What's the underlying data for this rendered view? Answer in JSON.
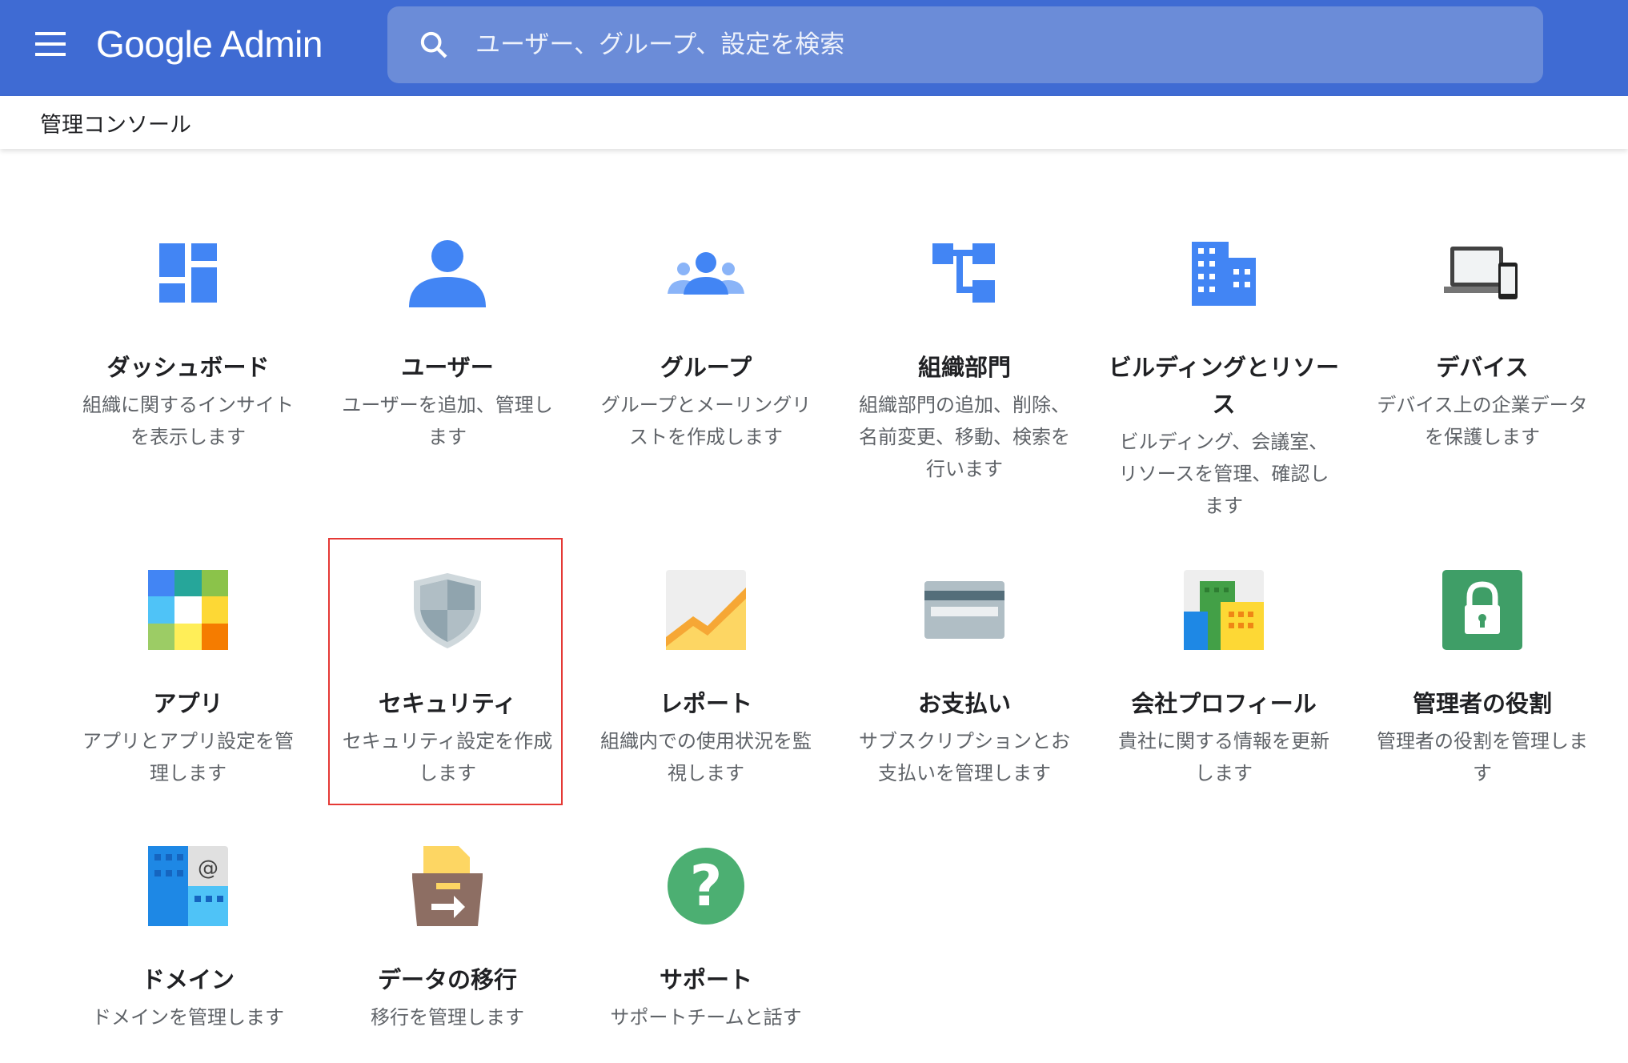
{
  "header": {
    "app_title": "Google Admin",
    "search_placeholder": "ユーザー、グループ、設定を検索"
  },
  "breadcrumb": "管理コンソール",
  "cards": [
    {
      "title": "ダッシュボード",
      "desc": "組織に関するインサイトを表示します",
      "icon": "dashboard-icon"
    },
    {
      "title": "ユーザー",
      "desc": "ユーザーを追加、管理します",
      "icon": "user-icon"
    },
    {
      "title": "グループ",
      "desc": "グループとメーリングリストを作成します",
      "icon": "group-icon"
    },
    {
      "title": "組織部門",
      "desc": "組織部門の追加、削除、名前変更、移動、検索を行います",
      "icon": "org-unit-icon"
    },
    {
      "title": "ビルディングとリソース",
      "desc": "ビルディング、会議室、リソースを管理、確認します",
      "icon": "building-icon"
    },
    {
      "title": "デバイス",
      "desc": "デバイス上の企業データを保護します",
      "icon": "devices-icon"
    },
    {
      "title": "アプリ",
      "desc": "アプリとアプリ設定を管理します",
      "icon": "apps-icon"
    },
    {
      "title": "セキュリティ",
      "desc": "セキュリティ設定を作成します",
      "icon": "shield-icon",
      "highlighted": true
    },
    {
      "title": "レポート",
      "desc": "組織内での使用状況を監視します",
      "icon": "reports-icon"
    },
    {
      "title": "お支払い",
      "desc": "サブスクリプションとお支払いを管理します",
      "icon": "credit-card-icon"
    },
    {
      "title": "会社プロフィール",
      "desc": "貴社に関する情報を更新します",
      "icon": "company-icon"
    },
    {
      "title": "管理者の役割",
      "desc": "管理者の役割を管理します",
      "icon": "lock-icon"
    },
    {
      "title": "ドメイン",
      "desc": "ドメインを管理します",
      "icon": "domain-icon"
    },
    {
      "title": "データの移行",
      "desc": "移行を管理します",
      "icon": "migration-icon"
    },
    {
      "title": "サポート",
      "desc": "サポートチームと話す",
      "icon": "help-icon"
    }
  ],
  "colors": {
    "header": "#3f6bd3",
    "search": "#6b8cd8",
    "highlight": "#e53935"
  }
}
